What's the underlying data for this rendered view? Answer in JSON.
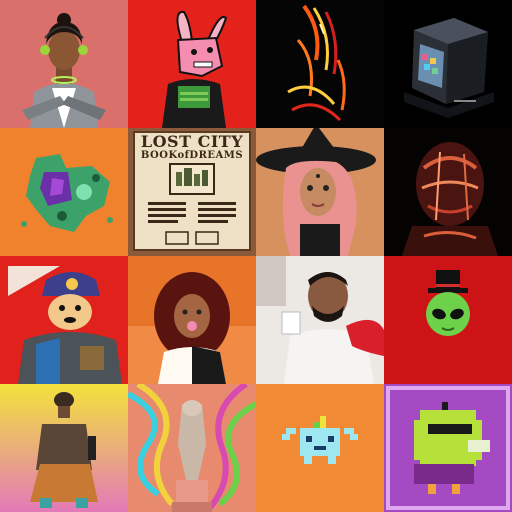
{
  "gallery": {
    "tiles": [
      {
        "name": "tile-woman-with-headset",
        "subject": "woman-with-headset",
        "bg": "#d9706b"
      },
      {
        "name": "tile-pink-rabbit",
        "subject": "pink-rabbit",
        "bg": "#e3221b"
      },
      {
        "name": "tile-neon-figure",
        "subject": "neon-figure",
        "bg": "#050505"
      },
      {
        "name": "tile-glass-display-case",
        "subject": "glass-display-case",
        "bg": "#000000"
      },
      {
        "name": "tile-green-map",
        "subject": "green-map",
        "bg": "#f0822e"
      },
      {
        "name": "tile-lost-city-book",
        "subject": "lost-city-book",
        "bg": "#ede0c4",
        "title_line1": "LOST CITY",
        "title_line2": "BOOKofDREAMS"
      },
      {
        "name": "tile-witch-woman",
        "subject": "witch-woman",
        "bg": "#d6915f"
      },
      {
        "name": "tile-chrome-head",
        "subject": "chrome-head",
        "bg": "#050202"
      },
      {
        "name": "tile-armored-dog",
        "subject": "armored-dog",
        "bg": "#e0211c"
      },
      {
        "name": "tile-curly-hair-woman",
        "subject": "curly-hair-woman",
        "bg": "#e8742a"
      },
      {
        "name": "tile-man-with-cup",
        "subject": "man-with-cup",
        "bg": "#ece8e4"
      },
      {
        "name": "tile-alien-top-hat",
        "subject": "alien-top-hat",
        "bg": "#cc1316"
      },
      {
        "name": "tile-yellow-figure",
        "subject": "yellow-figure",
        "bg": "#e6d43a"
      },
      {
        "name": "tile-psychedelic-statue",
        "subject": "psychedelic-statue",
        "bg": "#e88a6d"
      },
      {
        "name": "tile-pixel-axolotl",
        "subject": "pixel-axolotl",
        "bg": "#f08a35"
      },
      {
        "name": "tile-pixel-green-bird",
        "subject": "pixel-green-bird",
        "bg": "#a44ac2"
      }
    ]
  }
}
